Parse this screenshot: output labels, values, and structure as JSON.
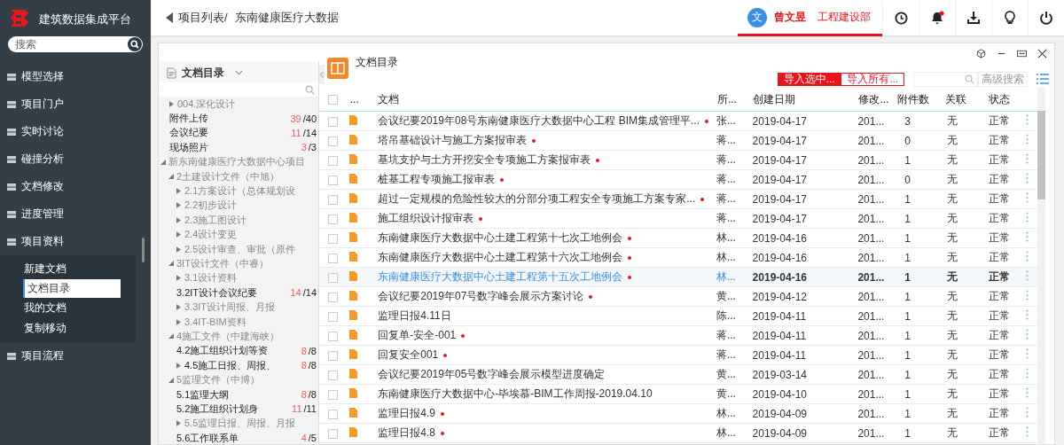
{
  "app": {
    "title": "建筑数据集成平台",
    "search": {
      "placeholder": "搜索"
    }
  },
  "sidebar": {
    "items": [
      {
        "label": "模型选择"
      },
      {
        "label": "项目门户"
      },
      {
        "label": "实时讨论"
      },
      {
        "label": "碰撞分析"
      },
      {
        "label": "文档修改"
      },
      {
        "label": "进度管理"
      },
      {
        "label": "项目资料",
        "children": [
          {
            "label": "新建文档",
            "selected": false
          },
          {
            "label": "文档目录",
            "selected": true
          },
          {
            "label": "我的文档",
            "selected": false
          },
          {
            "label": "复制移动",
            "selected": false
          }
        ]
      },
      {
        "label": "项目流程"
      }
    ]
  },
  "topbar": {
    "breadcrumb": [
      "项目列表/",
      "东南健康医疗大数据"
    ],
    "user": {
      "avatar": "文",
      "name": "曾文昱",
      "department": "工程建设部"
    },
    "notifications_unread": true
  },
  "tree_panel": {
    "title": "文档目录",
    "nodes": [
      {
        "label": "004.深化设计",
        "expanded": false
      },
      {
        "label": "附件上传",
        "count": "39",
        "total": "/40"
      },
      {
        "label": "会议纪要",
        "count": "11",
        "total": "/14"
      },
      {
        "label": "现场照片",
        "count": "3",
        "total": "/3"
      },
      {
        "label": "新东南健康医疗大数据中心项目",
        "expanded": true,
        "children": [
          {
            "label": "2土建设计文件（中旭）",
            "expanded": true,
            "children": [
              {
                "label": "2.1方案设计（总体规划设",
                "expanded": false
              },
              {
                "label": "2.2初步设计",
                "expanded": false
              },
              {
                "label": "2.3施工图设计",
                "expanded": false
              },
              {
                "label": "2.4设计变更",
                "expanded": false
              },
              {
                "label": "2.5设计审查、审批（原件",
                "expanded": false
              }
            ]
          },
          {
            "label": "3IT设计文件（中睿）",
            "expanded": true,
            "children": [
              {
                "label": "3.1设计资料",
                "expanded": false
              },
              {
                "label": "3.2IT设计会议纪要",
                "count": "14",
                "total": "/14"
              },
              {
                "label": "3.3IT设计周报、月报",
                "expanded": false
              },
              {
                "label": "3.4IT-BIM资料",
                "expanded": false
              }
            ]
          },
          {
            "label": "4施工文件（中建海峡）",
            "expanded": true,
            "children": [
              {
                "label": "4.2施工组织计划等资",
                "count": "8",
                "total": "/8"
              },
              {
                "label": "4.5施工日报、周报、",
                "expanded": false,
                "count": "8",
                "total": "/8"
              }
            ]
          },
          {
            "label": "5监理文件（中博）",
            "expanded": true,
            "children": [
              {
                "label": "5.1监理大纲",
                "count": "8",
                "total": "/8"
              },
              {
                "label": "5.2施工组织计划身",
                "count": "11",
                "total": "/11"
              },
              {
                "label": "5.5监理日报、周报、月报",
                "expanded": false
              },
              {
                "label": "5.6工作联系单",
                "count": "4",
                "total": "/5"
              }
            ]
          }
        ]
      }
    ]
  },
  "documents": {
    "title": "文档目录",
    "buttons": [
      "导入选中...",
      "导入所有..."
    ],
    "advanced_search": "高级搜索",
    "select_all_checked": false,
    "columns": [
      "...",
      "文档",
      "所...",
      "创建日期",
      "修改...",
      "附件数",
      "关联",
      "状态"
    ],
    "rows": [
      {
        "title": "会议纪要2019年08号东南健康医疗大数据中心工程 BIM集成管理平...",
        "flagged": true,
        "owner": "张...",
        "created": "2019-04-17",
        "modified": "201...",
        "attachments": "3",
        "relation": "无",
        "status": "正常",
        "selected": false,
        "checked": false
      },
      {
        "title": "塔吊基础设计与施工方案报审表",
        "flagged": true,
        "owner": "蒋...",
        "created": "2019-04-17",
        "modified": "201...",
        "attachments": "0",
        "relation": "无",
        "status": "正常",
        "selected": false,
        "checked": false
      },
      {
        "title": "基坑支护与土方开挖安全专项施工方案报审表",
        "flagged": true,
        "owner": "蒋...",
        "created": "2019-04-17",
        "modified": "201...",
        "attachments": "1",
        "relation": "无",
        "status": "正常",
        "selected": false,
        "checked": false
      },
      {
        "title": "桩基工程专项施工报审表",
        "flagged": true,
        "owner": "蒋...",
        "created": "2019-04-17",
        "modified": "201...",
        "attachments": "0",
        "relation": "无",
        "status": "正常",
        "selected": false,
        "checked": false
      },
      {
        "title": "超过一定规模的危险性较大的分部分项工程安全专项施工方案专家...",
        "flagged": true,
        "owner": "蒋...",
        "created": "2019-04-17",
        "modified": "201...",
        "attachments": "1",
        "relation": "无",
        "status": "正常",
        "selected": false,
        "checked": false
      },
      {
        "title": "施工组织设计报审表",
        "flagged": true,
        "owner": "蒋...",
        "created": "2019-04-17",
        "modified": "201...",
        "attachments": "1",
        "relation": "无",
        "status": "正常",
        "selected": false,
        "checked": false
      },
      {
        "title": "东南健康医疗大数据中心土建工程第十七次工地例会",
        "flagged": true,
        "owner": "林...",
        "created": "2019-04-16",
        "modified": "201...",
        "attachments": "1",
        "relation": "无",
        "status": "正常",
        "selected": false,
        "checked": false
      },
      {
        "title": "东南健康医疗大数据中心土建工程第十六次工地例会",
        "flagged": true,
        "owner": "林...",
        "created": "2019-04-16",
        "modified": "201...",
        "attachments": "1",
        "relation": "无",
        "status": "正常",
        "selected": false,
        "checked": false
      },
      {
        "title": "东南健康医疗大数据中心土建工程第十五次工地例会",
        "flagged": true,
        "owner": "林...",
        "created": "2019-04-16",
        "modified": "201...",
        "attachments": "1",
        "relation": "无",
        "status": "正常",
        "selected": true,
        "checked": false
      },
      {
        "title": "会议纪要2019年07号数字峰会展示方案讨论",
        "flagged": true,
        "owner": "黄...",
        "created": "2019-04-12",
        "modified": "201...",
        "attachments": "1",
        "relation": "无",
        "status": "正常",
        "selected": false,
        "checked": false
      },
      {
        "title": "监理日报4.11日",
        "flagged": false,
        "owner": "陈...",
        "created": "2019-04-11",
        "modified": "201...",
        "attachments": "1",
        "relation": "无",
        "status": "正常",
        "selected": false,
        "checked": false
      },
      {
        "title": "回复单-安全-001",
        "flagged": true,
        "owner": "蒋...",
        "created": "2019-04-11",
        "modified": "201...",
        "attachments": "1",
        "relation": "无",
        "status": "正常",
        "selected": false,
        "checked": false
      },
      {
        "title": "回复安全001",
        "flagged": true,
        "owner": "蒋...",
        "created": "2019-04-11",
        "modified": "201...",
        "attachments": "1",
        "relation": "无",
        "status": "正常",
        "selected": false,
        "checked": false
      },
      {
        "title": "会议纪要2019年05号数字峰会展示模型进度确定",
        "flagged": false,
        "owner": "黄...",
        "created": "2019-03-14",
        "modified": "201...",
        "attachments": "1",
        "relation": "无",
        "status": "正常",
        "selected": false,
        "checked": false
      },
      {
        "title": "东南健康医疗大数据中心-毕埃慕-BIM工作周报-2019.04.10",
        "flagged": false,
        "owner": "黄...",
        "created": "2019-04-10",
        "modified": "201...",
        "attachments": "1",
        "relation": "无",
        "status": "正常",
        "selected": false,
        "checked": false
      },
      {
        "title": "监理日报4.9",
        "flagged": true,
        "owner": "林...",
        "created": "2019-04-09",
        "modified": "201...",
        "attachments": "1",
        "relation": "无",
        "status": "正常",
        "selected": false,
        "checked": false
      },
      {
        "title": "监理日报4.8",
        "flagged": true,
        "owner": "林...",
        "created": "2019-04-09",
        "modified": "201...",
        "attachments": "1",
        "relation": "无",
        "status": "正常",
        "selected": false,
        "checked": false
      }
    ]
  }
}
